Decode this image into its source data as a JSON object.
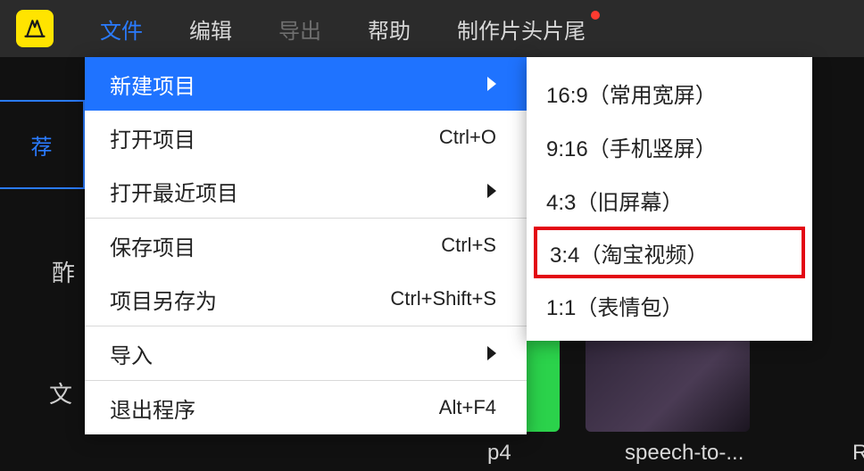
{
  "menubar": {
    "items": [
      {
        "label": "文件"
      },
      {
        "label": "编辑"
      },
      {
        "label": "导出"
      },
      {
        "label": "帮助"
      },
      {
        "label": "制作片头片尾"
      }
    ]
  },
  "sidebar": {
    "tab_char": "荐"
  },
  "background": {
    "text1": "酢",
    "text2": "文",
    "clip1": "p4",
    "clip2": "speech-to-...",
    "clip3": "R"
  },
  "file_menu": {
    "items": [
      {
        "label": "新建项目",
        "shortcut": "",
        "has_submenu": true,
        "highlight": true
      },
      {
        "label": "打开项目",
        "shortcut": "Ctrl+O",
        "has_submenu": false
      },
      {
        "label": "打开最近项目",
        "shortcut": "",
        "has_submenu": true
      },
      {
        "label": "保存项目",
        "shortcut": "Ctrl+S",
        "has_submenu": false
      },
      {
        "label": "项目另存为",
        "shortcut": "Ctrl+Shift+S",
        "has_submenu": false
      },
      {
        "label": "导入",
        "shortcut": "",
        "has_submenu": true
      },
      {
        "label": "退出程序",
        "shortcut": "Alt+F4",
        "has_submenu": false
      }
    ]
  },
  "submenu": {
    "items": [
      {
        "label": "16:9（常用宽屏）"
      },
      {
        "label": "9:16（手机竖屏）"
      },
      {
        "label": "4:3（旧屏幕）"
      },
      {
        "label": "3:4（淘宝视频）"
      },
      {
        "label": "1:1（表情包）"
      }
    ]
  }
}
